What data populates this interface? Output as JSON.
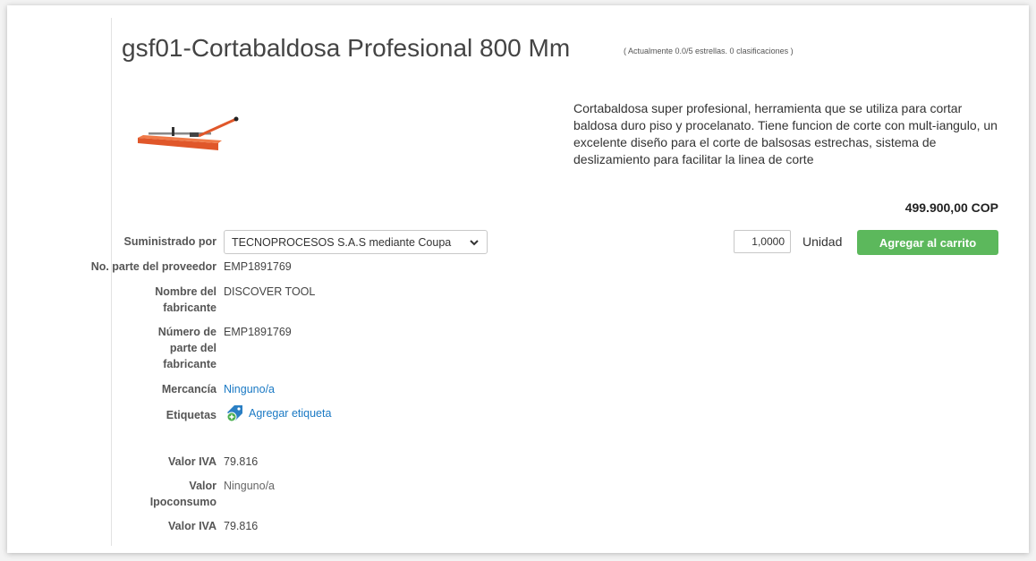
{
  "product": {
    "title": "gsf01-Cortabaldosa Profesional 800 Mm",
    "rating_text": "( Actualmente 0.0/5 estrellas. 0 clasificaciones )",
    "image_icon": "tile-cutter-product-image",
    "description": "Cortabaldosa super profesional, herramienta que se utiliza para cortar baldosa duro piso y procelanato. Tiene funcion de corte con mult-iangulo, un excelente diseño para el corte de balsosas estrechas, sistema de deslizamiento para facilitar la linea de corte",
    "price": "499.900,00 COP"
  },
  "purchase": {
    "quantity": "1,0000",
    "unit": "Unidad",
    "add_to_cart_label": "Agregar al carrito",
    "button_color": "#5cb85c"
  },
  "fields": {
    "supplier": {
      "label": "Suministrado por",
      "value": "TECNOPROCESOS S.A.S mediante Coupa"
    },
    "supplier_part": {
      "label": "No. parte del proveedor",
      "value": "EMP1891769"
    },
    "manufacturer": {
      "label": "Nombre del fabricante",
      "value": "DISCOVER TOOL"
    },
    "manufacturer_part": {
      "label": "Número de parte del fabricante",
      "value": "EMP1891769"
    },
    "commodity": {
      "label": "Mercancía",
      "value": "Ninguno/a"
    },
    "tags": {
      "label": "Etiquetas",
      "value": "Agregar etiqueta",
      "icon": "add-tag-icon"
    },
    "iva_1": {
      "label": "Valor IVA",
      "value": "79.816"
    },
    "ipoconsumo": {
      "label": "Valor Ipoconsumo",
      "value": "Ninguno/a"
    },
    "iva_2": {
      "label": "Valor IVA",
      "value": "79.816"
    }
  },
  "colors": {
    "link": "#1a79c4",
    "accent_green": "#5cb85c"
  }
}
